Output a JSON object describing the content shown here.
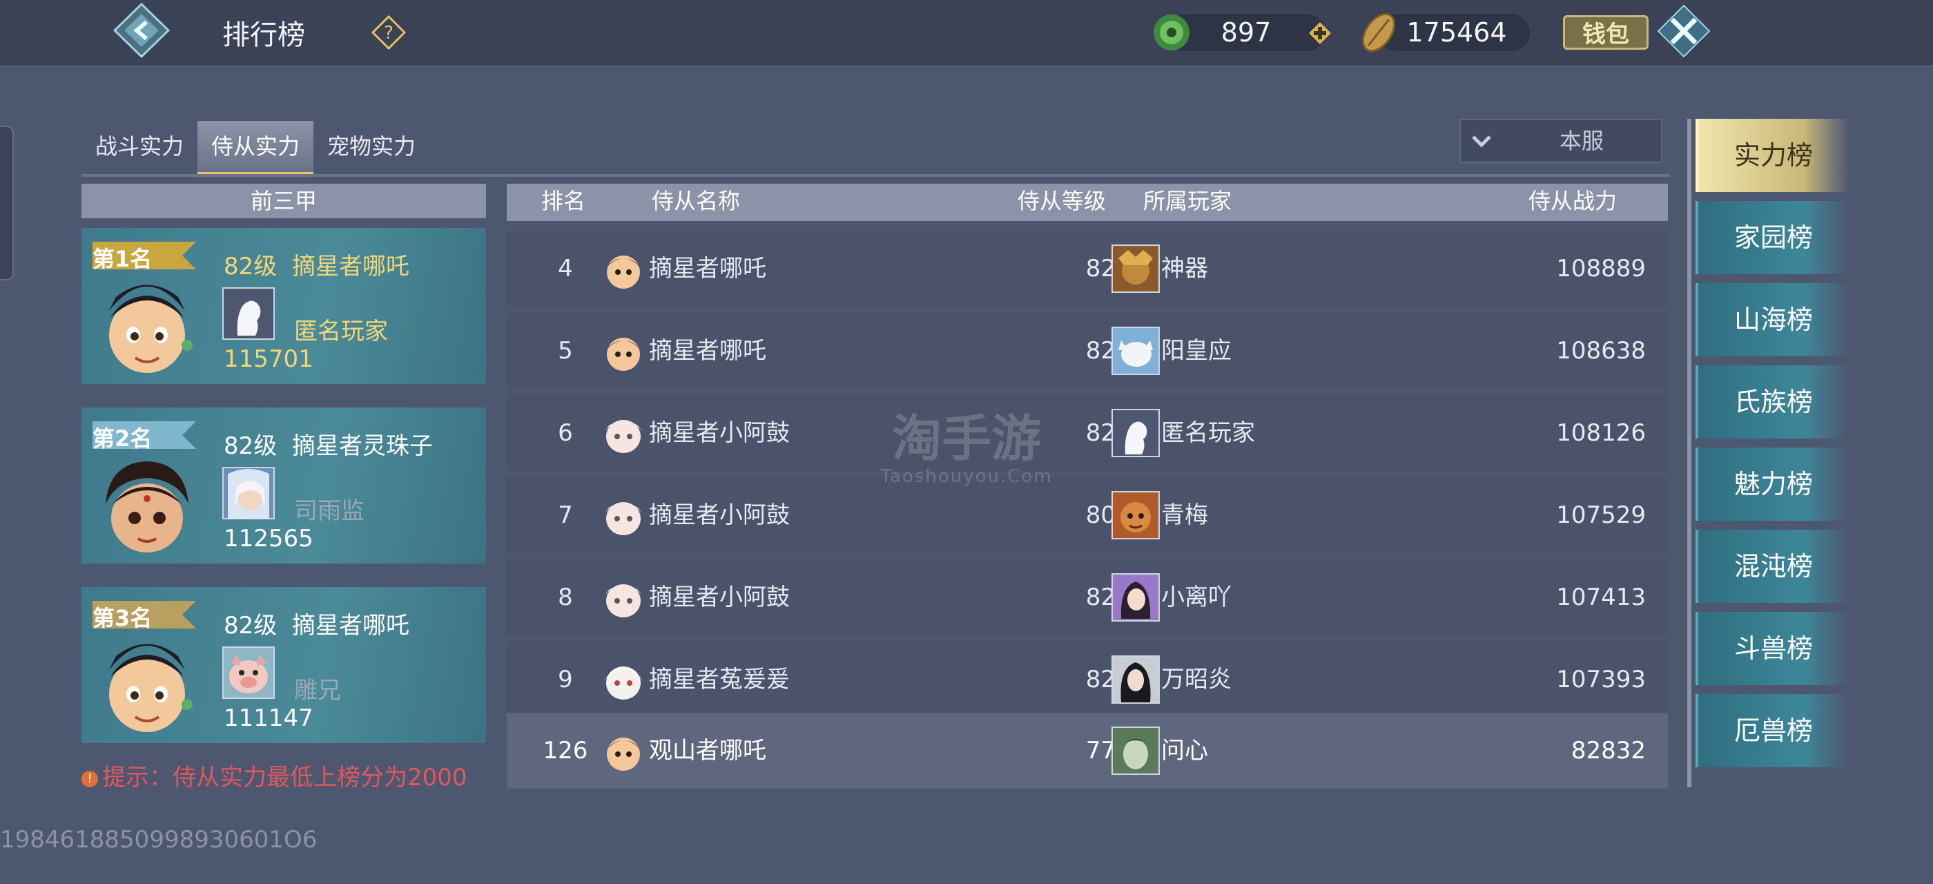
{
  "header": {
    "title": "排行榜",
    "currency_jade": "897",
    "currency_coin": "175464",
    "wallet_label": "钱包"
  },
  "tabs": [
    {
      "label": "战斗实力",
      "active": false
    },
    {
      "label": "侍从实力",
      "active": true
    },
    {
      "label": "宠物实力",
      "active": false
    }
  ],
  "server_filter": "本服",
  "top3": {
    "header": "前三甲",
    "cards": [
      {
        "rank_label": "第1名",
        "level": "82级",
        "pet_name": "摘星者哪吒",
        "owner": "匿名玩家",
        "power": "115701"
      },
      {
        "rank_label": "第2名",
        "level": "82级",
        "pet_name": "摘星者灵珠子",
        "owner": "司雨监",
        "power": "112565"
      },
      {
        "rank_label": "第3名",
        "level": "82级",
        "pet_name": "摘星者哪吒",
        "owner": "雕兄",
        "power": "111147"
      }
    ]
  },
  "hint": "提示：侍从实力最低上榜分为2000",
  "table": {
    "headers": {
      "rank": "排名",
      "pet_name": "侍从名称",
      "level": "侍从等级",
      "owner": "所属玩家",
      "power": "侍从战力"
    },
    "rows": [
      {
        "rank": "4",
        "pet_name": "摘星者哪吒",
        "level": "82级",
        "owner": "神器",
        "power": "108889"
      },
      {
        "rank": "5",
        "pet_name": "摘星者哪吒",
        "level": "82级",
        "owner": "阳皇应",
        "power": "108638"
      },
      {
        "rank": "6",
        "pet_name": "摘星者小阿鼓",
        "level": "82级",
        "owner": "匿名玩家",
        "power": "108126"
      },
      {
        "rank": "7",
        "pet_name": "摘星者小阿鼓",
        "level": "80级",
        "owner": "青梅",
        "power": "107529"
      },
      {
        "rank": "8",
        "pet_name": "摘星者小阿鼓",
        "level": "82级",
        "owner": "小离吖",
        "power": "107413"
      },
      {
        "rank": "9",
        "pet_name": "摘星者菟爰爰",
        "level": "82级",
        "owner": "万昭炎",
        "power": "107393"
      }
    ],
    "my_row": {
      "rank": "126",
      "pet_name": "观山者哪吒",
      "level": "77级",
      "owner": "问心",
      "power": "82832"
    }
  },
  "nav": [
    "实力榜",
    "家园榜",
    "山海榜",
    "氏族榜",
    "魅力榜",
    "混沌榜",
    "斗兽榜",
    "厄兽榜"
  ],
  "watermark": {
    "cn": "淘手游",
    "en": "Taoshouyou.Com"
  },
  "user_id": "1984618850998930601O6"
}
